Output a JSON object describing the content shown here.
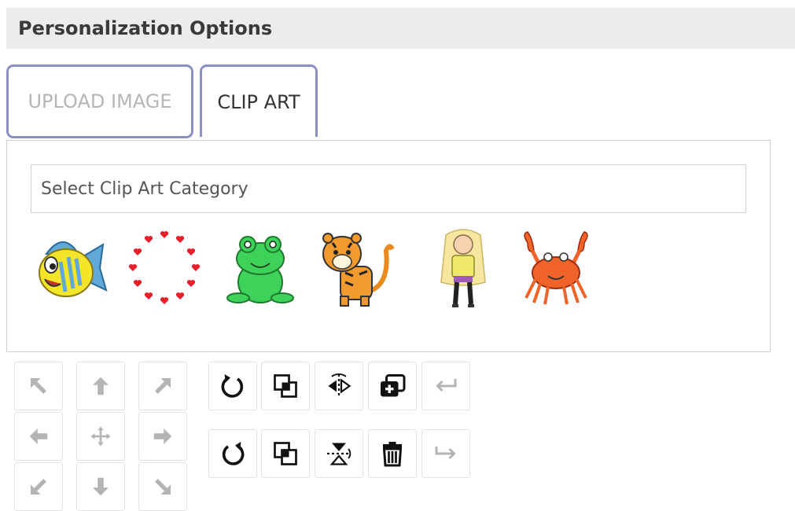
{
  "header": {
    "title": "Personalization Options"
  },
  "tabs": [
    {
      "label": "UPLOAD IMAGE",
      "active": false
    },
    {
      "label": "CLIP ART",
      "active": true
    }
  ],
  "clipart": {
    "category_select": {
      "selected_text": "Select Clip Art Category"
    },
    "items": [
      {
        "name": "fish"
      },
      {
        "name": "heart-wreath"
      },
      {
        "name": "frog"
      },
      {
        "name": "tiger"
      },
      {
        "name": "girl"
      },
      {
        "name": "crab"
      }
    ]
  },
  "controls": {
    "move": [
      "move-up-left-icon",
      "move-up-icon",
      "move-up-right-icon",
      "move-left-icon",
      "move-center-icon",
      "move-right-icon",
      "move-down-left-icon",
      "move-down-icon",
      "move-down-right-icon"
    ],
    "actions_row1": [
      "rotate-clockwise-icon",
      "bring-to-front-icon",
      "flip-horizontal-icon",
      "duplicate-icon",
      "undo-icon"
    ],
    "actions_row2": [
      "rotate-counterclockwise-icon",
      "send-to-back-icon",
      "flip-vertical-icon",
      "delete-icon",
      "redo-icon"
    ]
  },
  "colors": {
    "header_bg": "#ececec",
    "tab_border": "#8a90c4",
    "disabled_icon": "#b4b4b4",
    "active_icon": "#111111"
  }
}
